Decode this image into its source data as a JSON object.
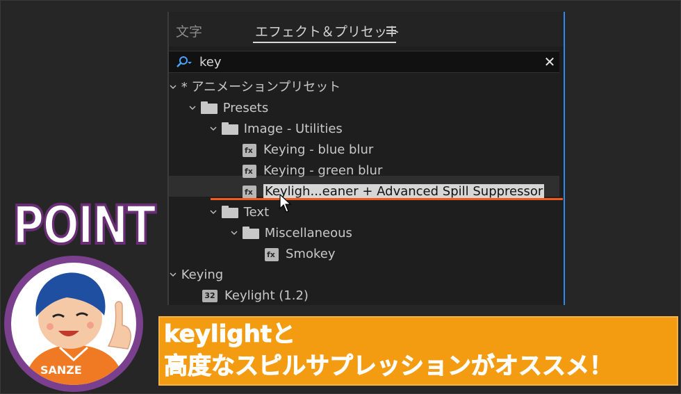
{
  "panel": {
    "tabs": [
      {
        "label": "文字"
      },
      {
        "label": "エフェクト＆プリセット"
      }
    ],
    "search": {
      "value": "key"
    }
  },
  "tree": [
    {
      "label": "* アニメーションプリセット"
    },
    {
      "label": "Presets"
    },
    {
      "label": "Image - Utilities"
    },
    {
      "label": "Keying - blue blur"
    },
    {
      "label": "Keying - green blur"
    },
    {
      "label": "Keyligh...eaner + Advanced Spill Suppressor"
    },
    {
      "label": "Text"
    },
    {
      "label": "Miscellaneous"
    },
    {
      "label": "Smokey"
    },
    {
      "label": "Keying"
    },
    {
      "label": "Keylight (1.2)",
      "badge": "32"
    }
  ],
  "overlay": {
    "point": "POINT",
    "character_shirt": "SANZE",
    "caption_line1": "keylightと",
    "caption_line2": "高度なスピルサプレッションがオススメ！"
  },
  "colors": {
    "accent_orange": "#f39c12",
    "point_purple": "#6a2e77",
    "selection_line": "#f05a1e",
    "panel_border_blue": "#2d8ceb"
  }
}
